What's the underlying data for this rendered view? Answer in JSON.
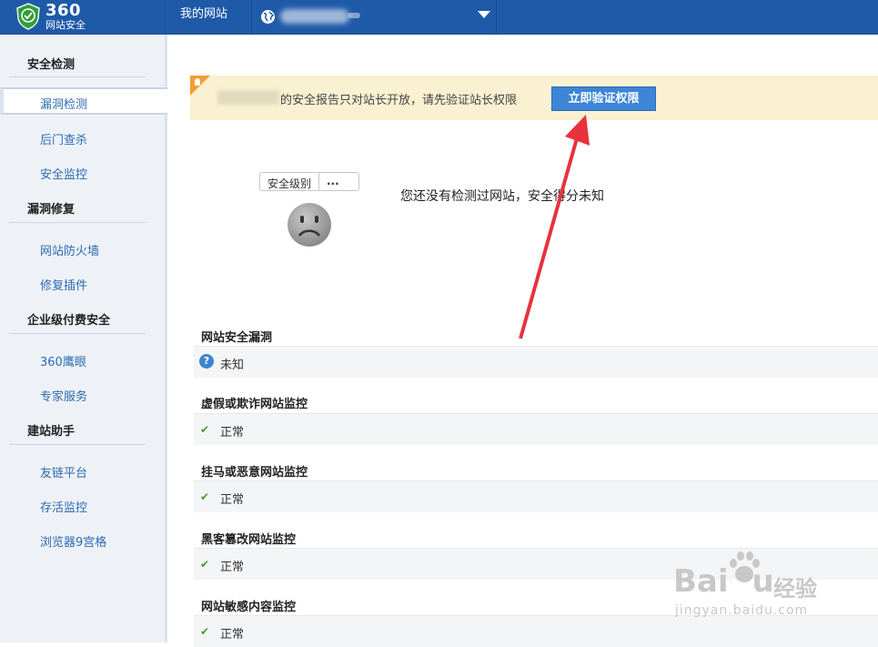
{
  "header": {
    "logo_num": "360",
    "logo_sub": "网站安全",
    "nav_mysite": "我的网站"
  },
  "sidebar": {
    "sections": [
      {
        "title": "安全检测",
        "items": [
          "漏洞检测",
          "后门查杀",
          "安全监控"
        ]
      },
      {
        "title": "漏洞修复",
        "items": [
          "网站防火墙",
          "修复插件"
        ]
      },
      {
        "title": "企业级付费安全",
        "items": [
          "360鹰眼",
          "专家服务"
        ]
      },
      {
        "title": "建站助手",
        "items": [
          "友链平台",
          "存活监控",
          "浏览器9宫格"
        ]
      }
    ],
    "active_item": "漏洞检测"
  },
  "notice": {
    "text": "的安全报告只对站长开放，请先验证站长权限",
    "button_label": "立即验证权限"
  },
  "score": {
    "level_label": "安全级别",
    "level_value": "...",
    "message": "您还没有检测过网站，安全得分未知"
  },
  "checks": [
    {
      "title": "网站安全漏洞",
      "status": "未知",
      "icon": "question-icon"
    },
    {
      "title": "虚假或欺诈网站监控",
      "status": "正常",
      "icon": "check-icon"
    },
    {
      "title": "挂马或恶意网站监控",
      "status": "正常",
      "icon": "check-icon"
    },
    {
      "title": "黑客篡改网站监控",
      "status": "正常",
      "icon": "check-icon"
    },
    {
      "title": "网站敏感内容监控",
      "status": "正常",
      "icon": "check-icon"
    }
  ],
  "watermark": {
    "brand": "Bai",
    "brand_end": "u",
    "cn": "经验",
    "url": "jingyan.baidu.com"
  },
  "colors": {
    "topbar": "#1f5aa9",
    "accent_blue": "#3d85d6",
    "notice_bg": "#faf1d2",
    "ok_green": "#4a9a2b",
    "arrow_red": "#e8323c"
  }
}
